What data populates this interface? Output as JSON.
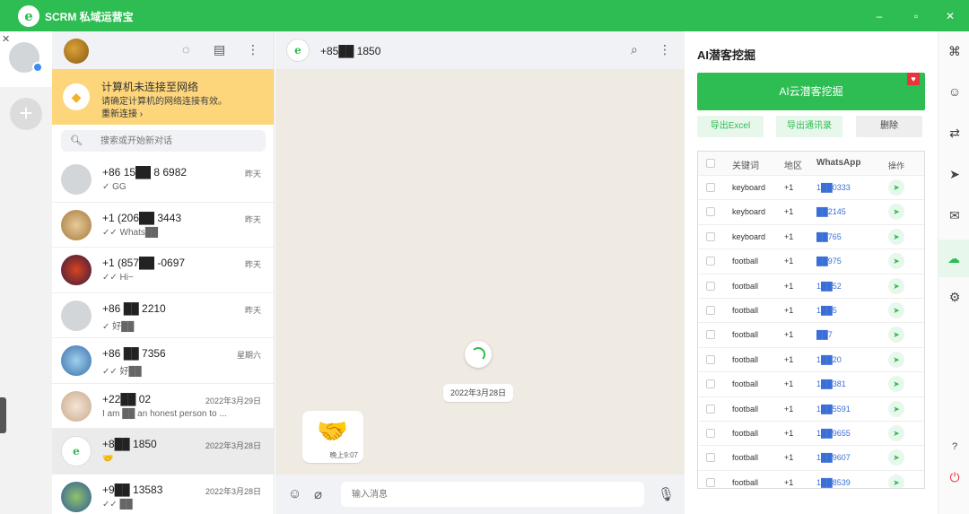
{
  "app": {
    "title": "SCRM 私域运营宝"
  },
  "titlebar": {
    "minimize": "–",
    "maximize": "▫",
    "close": "✕"
  },
  "rail": {
    "close": "✕",
    "add": "+"
  },
  "chatlist": {
    "warning": {
      "title": "计算机未连接至网络",
      "desc": "请确定计算机的网络连接有效。",
      "action": "重新连接 ›"
    },
    "search_placeholder": "搜索或开始新对话",
    "items": [
      {
        "name": "+86 15██ 8 6982",
        "time": "昨天",
        "preview": "✓ GG"
      },
      {
        "name": "+1 (206██ 3443",
        "time": "昨天",
        "preview": "✓✓ Whats██"
      },
      {
        "name": "+1 (857██ -0697",
        "time": "昨天",
        "preview": "✓✓ Hi~"
      },
      {
        "name": "+86 ██ 2210",
        "time": "昨天",
        "preview": "✓ 好██"
      },
      {
        "name": "+86 ██ 7356",
        "time": "星期六",
        "preview": "✓✓ 好██"
      },
      {
        "name": "+22██ 02",
        "time": "2022年3月29日",
        "preview": "I am ██ an honest person to ..."
      },
      {
        "name": "+8██ 1850",
        "time": "2022年3月28日",
        "preview": "🤝"
      },
      {
        "name": "+9██ 13583",
        "time": "2022年3月28日",
        "preview": "✓✓ ██"
      }
    ]
  },
  "conversation": {
    "contact": "+85██ 1850",
    "date": "2022年3月28日",
    "message": {
      "emoji": "🤝",
      "time": "晚上9:07"
    },
    "compose_placeholder": "输入消息"
  },
  "ai_panel": {
    "title": "AI潜客挖掘",
    "main_button": "AI云潜客挖掘",
    "export_excel": "导出Excel",
    "export_contacts": "导出通讯录",
    "delete": "删除",
    "columns": [
      "关键词",
      "地区",
      "WhatsApp",
      "操作"
    ],
    "rows": [
      {
        "keyword": "keyboard",
        "region": "+1",
        "whatsapp": "1██0333"
      },
      {
        "keyword": "keyboard",
        "region": "+1",
        "whatsapp": "██2145"
      },
      {
        "keyword": "keyboard",
        "region": "+1",
        "whatsapp": "██765"
      },
      {
        "keyword": "football",
        "region": "+1",
        "whatsapp": "██975"
      },
      {
        "keyword": "football",
        "region": "+1",
        "whatsapp": "1██52"
      },
      {
        "keyword": "football",
        "region": "+1",
        "whatsapp": "1██5"
      },
      {
        "keyword": "football",
        "region": "+1",
        "whatsapp": "██7"
      },
      {
        "keyword": "football",
        "region": "+1",
        "whatsapp": "1██20"
      },
      {
        "keyword": "football",
        "region": "+1",
        "whatsapp": "1██381"
      },
      {
        "keyword": "football",
        "region": "+1",
        "whatsapp": "1██5591"
      },
      {
        "keyword": "football",
        "region": "+1",
        "whatsapp": "1██9655"
      },
      {
        "keyword": "football",
        "region": "+1",
        "whatsapp": "1██9607"
      },
      {
        "keyword": "football",
        "region": "+1",
        "whatsapp": "1██8539"
      }
    ]
  },
  "colors": {
    "brand": "#2dbd52",
    "warning": "#fdd57b",
    "chat_bg": "#efeae2"
  }
}
